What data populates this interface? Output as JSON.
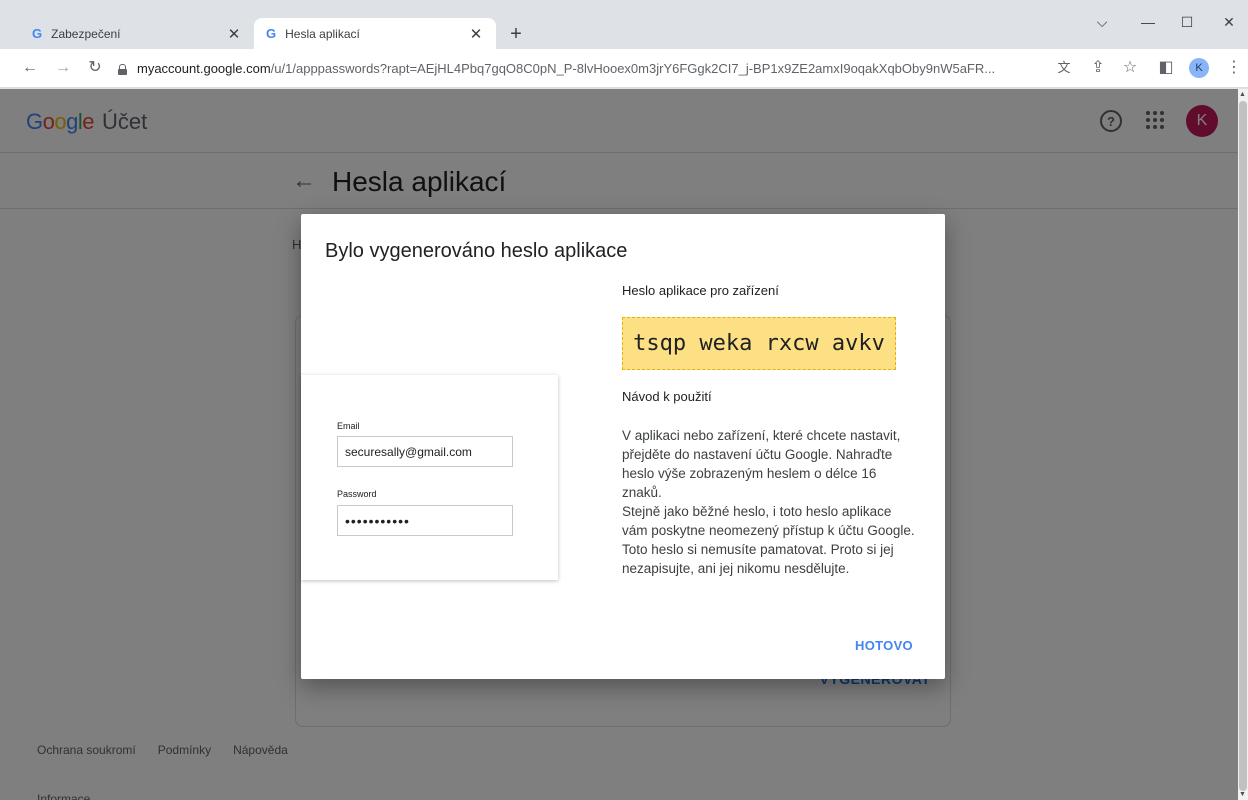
{
  "browser": {
    "tabs": [
      {
        "favicon": "G",
        "title": "Zabezpečení",
        "close": "✕"
      },
      {
        "favicon": "G",
        "title": "Hesla aplikací",
        "close": "✕"
      }
    ],
    "new_tab": "+",
    "window_controls": {
      "dropdown": "⌵",
      "minimize": "—",
      "maximize": "☐",
      "close": "✕"
    },
    "url_host": "myaccount.google.com",
    "url_rest": "/u/1/apppasswords?rapt=AEjHL4Pbq7gqO8C0pN_P-8lvHooex0m3jrY6FGgk2CI7_j-BP1x9ZE2amxI9oqakXqbOby9nW5aFR...",
    "profile_initial": "K"
  },
  "header": {
    "logo": {
      "G": "G",
      "o1": "o",
      "o2": "o",
      "g": "g",
      "l": "l",
      "e": "e"
    },
    "product": "Účet",
    "help": "?",
    "avatar_initial": "K"
  },
  "page": {
    "title": "Hesla aplikací",
    "desc_fragment": "H d ir",
    "generate_button": "VYGENEROVAT"
  },
  "footer": {
    "privacy": "Ochrana soukromí",
    "terms": "Podmínky",
    "help": "Nápověda",
    "info": "Informace"
  },
  "dialog": {
    "title": "Bylo vygenerováno heslo aplikace",
    "illustration": {
      "email_label": "Email",
      "email_value": "securesally@gmail.com",
      "password_label": "Password",
      "password_value": "•••••••••••"
    },
    "password_heading": "Heslo aplikace pro zařízení",
    "app_password": "tsqp weka rxcw avkv",
    "howto_heading": "Návod k použití",
    "instructions_p1": "V aplikaci nebo zařízení, které chcete nastavit, přejděte do nastavení účtu Google. Nahraďte heslo výše zobrazeným heslem o délce 16 znaků.",
    "instructions_p2": "Stejně jako běžné heslo, i toto heslo aplikace vám poskytne neomezený přístup k účtu Google. Toto heslo si nemusíte pamatovat. Proto si jej nezapisujte, ani jej nikomu nesdělujte.",
    "done_button": "HOTOVO"
  },
  "colors": {
    "accent": "#4285f4",
    "password_highlight": "#fce083",
    "avatar": "#c2185b"
  }
}
